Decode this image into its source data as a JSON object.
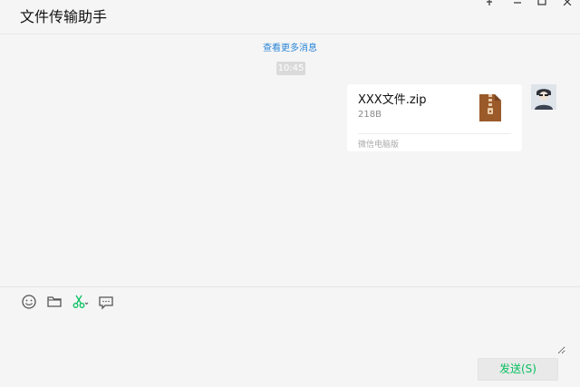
{
  "window": {
    "title": "文件传输助手"
  },
  "chat": {
    "more_messages": "查看更多消息",
    "timestamp": "10:45",
    "messages": [
      {
        "file_name": "XXX文件.zip",
        "file_size": "218B",
        "source": "微信电脑版",
        "file_icon": "zip-archive-icon"
      }
    ]
  },
  "toolbar": {
    "icons": [
      "emoji-icon",
      "folder-icon",
      "scissors-icon",
      "chat-bubble-icon"
    ]
  },
  "composer": {
    "send_label": "发送(S)"
  },
  "colors": {
    "accent_green": "#07c160",
    "link_blue": "#2b86d8",
    "zip_brown": "#9a5a2a"
  }
}
